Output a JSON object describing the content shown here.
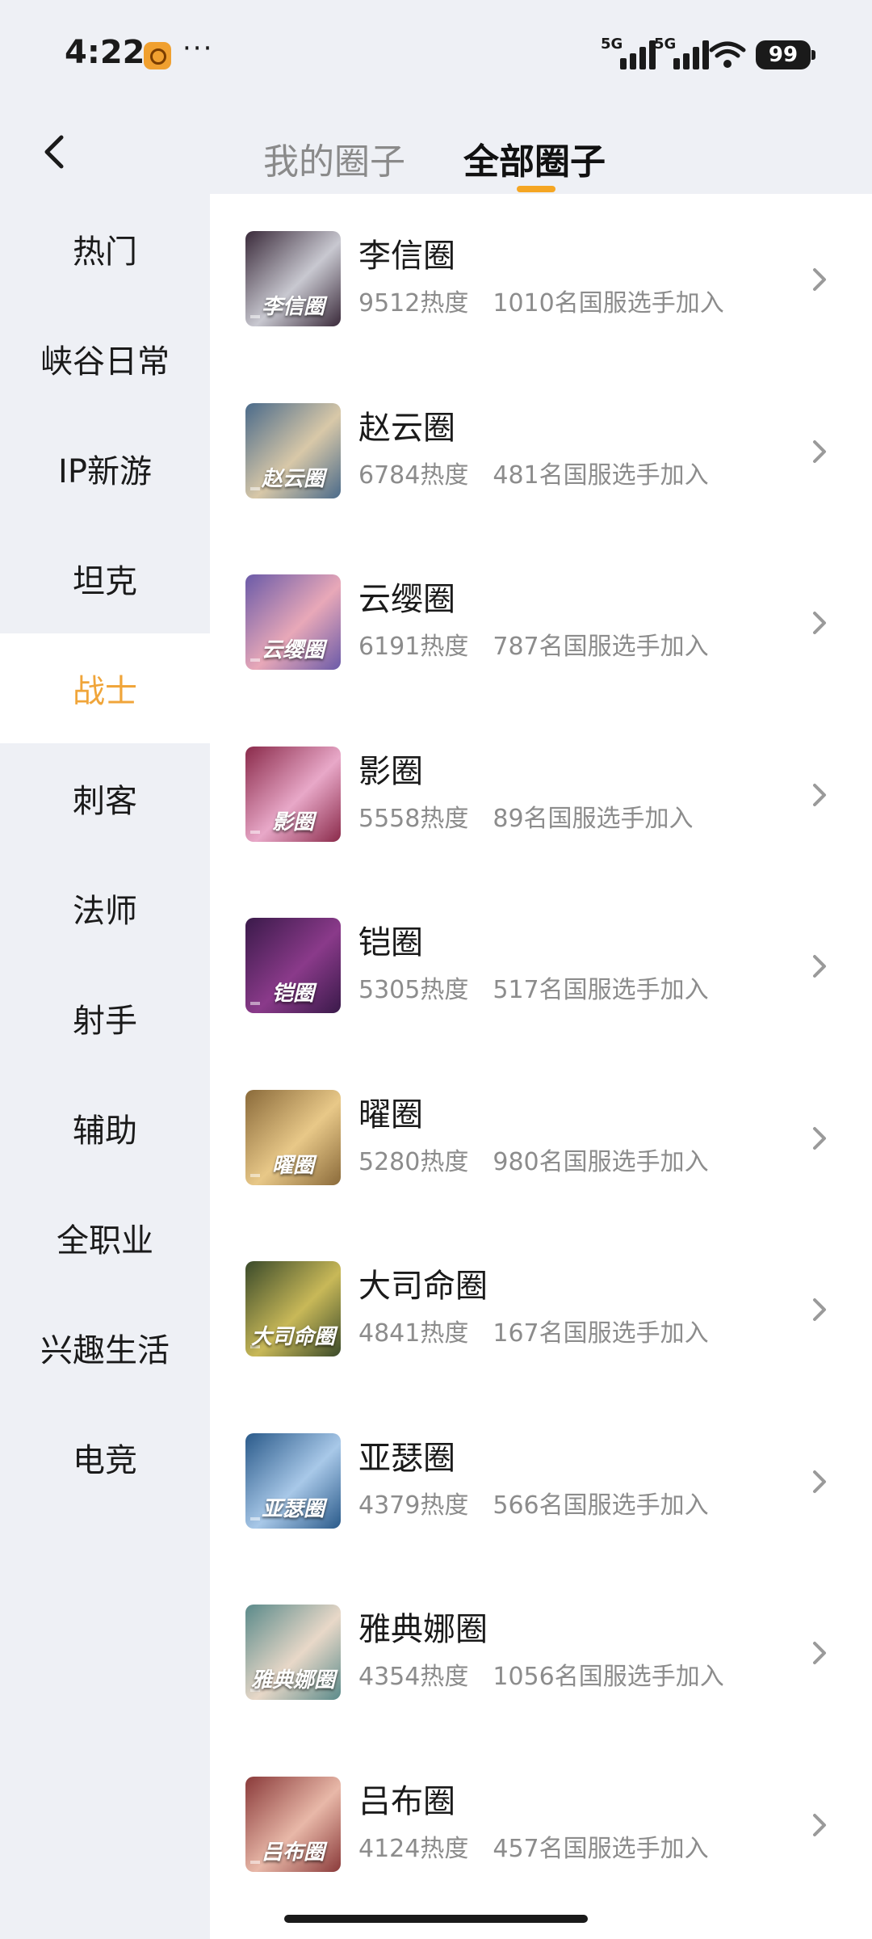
{
  "status_bar": {
    "time": "4:22",
    "more": "···",
    "network_1": "5G",
    "network_2": "5G",
    "battery": "99"
  },
  "header": {
    "tabs": [
      {
        "label": "我的圈子",
        "active": false
      },
      {
        "label": "全部圈子",
        "active": true
      }
    ],
    "accent_color": "#f5a623"
  },
  "sidebar": {
    "items": [
      {
        "label": "热门"
      },
      {
        "label": "峡谷日常"
      },
      {
        "label": "IP新游"
      },
      {
        "label": "坦克"
      },
      {
        "label": "战士",
        "active": true
      },
      {
        "label": "刺客"
      },
      {
        "label": "法师"
      },
      {
        "label": "射手"
      },
      {
        "label": "辅助"
      },
      {
        "label": "全职业"
      },
      {
        "label": "兴趣生活"
      },
      {
        "label": "电竞"
      }
    ],
    "active_color": "#f0a53a"
  },
  "circles": [
    {
      "name": "李信圈",
      "badge": "李信圈",
      "heat": "9512热度",
      "members": "1010名国服选手加入",
      "colors": [
        "#3a2a3a",
        "#c8c8d0"
      ]
    },
    {
      "name": "赵云圈",
      "badge": "赵云圈",
      "heat": "6784热度",
      "members": "481名国服选手加入",
      "colors": [
        "#4a6a8a",
        "#d8c8a8"
      ]
    },
    {
      "name": "云缨圈",
      "badge": "云缨圈",
      "heat": "6191热度",
      "members": "787名国服选手加入",
      "colors": [
        "#6a5aa8",
        "#e8a8b8"
      ]
    },
    {
      "name": "影圈",
      "badge": "影圈",
      "heat": "5558热度",
      "members": "89名国服选手加入",
      "colors": [
        "#8a2a4a",
        "#e8a8c8"
      ]
    },
    {
      "name": "铠圈",
      "badge": "铠圈",
      "heat": "5305热度",
      "members": "517名国服选手加入",
      "colors": [
        "#3a1a4a",
        "#8a3a8a"
      ]
    },
    {
      "name": "曜圈",
      "badge": "曜圈",
      "heat": "5280热度",
      "members": "980名国服选手加入",
      "colors": [
        "#8a6a3a",
        "#e8c888"
      ]
    },
    {
      "name": "大司命圈",
      "badge": "大司命圈",
      "heat": "4841热度",
      "members": "167名国服选手加入",
      "colors": [
        "#3a4a2a",
        "#c8b858"
      ]
    },
    {
      "name": "亚瑟圈",
      "badge": "亚瑟圈",
      "heat": "4379热度",
      "members": "566名国服选手加入",
      "colors": [
        "#2a5a8a",
        "#a8c8e8"
      ]
    },
    {
      "name": "雅典娜圈",
      "badge": "雅典娜圈",
      "heat": "4354热度",
      "members": "1056名国服选手加入",
      "colors": [
        "#5a8a8a",
        "#e8d8c8"
      ]
    },
    {
      "name": "吕布圈",
      "badge": "吕布圈",
      "heat": "4124热度",
      "members": "457名国服选手加入",
      "colors": [
        "#8a3a3a",
        "#e8b8a8"
      ]
    }
  ]
}
